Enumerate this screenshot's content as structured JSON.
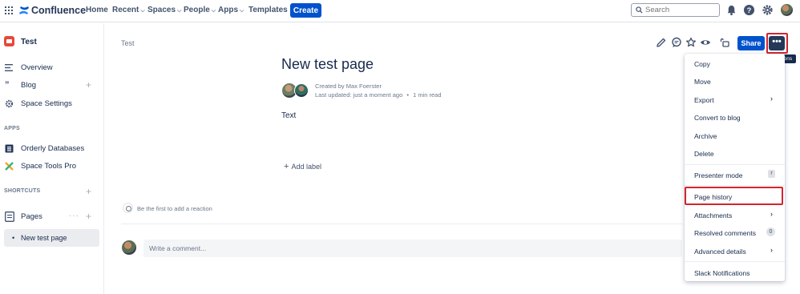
{
  "topnav": {
    "logo_text": "Confluence",
    "items": [
      {
        "label": "Home",
        "has_menu": false
      },
      {
        "label": "Recent",
        "has_menu": true
      },
      {
        "label": "Spaces",
        "has_menu": true
      },
      {
        "label": "People",
        "has_menu": true
      },
      {
        "label": "Apps",
        "has_menu": true
      },
      {
        "label": "Templates",
        "has_menu": false
      }
    ],
    "create_label": "Create",
    "search_placeholder": "Search",
    "icons": [
      "app-switcher-icon",
      "notifications-icon",
      "help-icon",
      "settings-icon"
    ],
    "brand_color": "#0052cc"
  },
  "sidebar": {
    "space_name": "Test",
    "items": [
      {
        "label": "Overview",
        "icon": "overview-icon"
      },
      {
        "label": "Blog",
        "icon": "blog-quote-icon"
      },
      {
        "label": "Space Settings",
        "icon": "gear-icon"
      }
    ],
    "apps_heading": "APPS",
    "apps": [
      {
        "label": "Orderly Databases",
        "icon": "database-icon"
      },
      {
        "label": "Space Tools Pro",
        "icon": "space-tools-icon"
      }
    ],
    "shortcuts_heading": "SHORTCUTS",
    "pages_label": "Pages",
    "tree": [
      {
        "label": "New test page",
        "selected": true
      }
    ]
  },
  "page": {
    "breadcrumb": "Test",
    "title": "New test page",
    "created_by": "Created by Max Foerster",
    "last_updated": "Last updated: just a moment ago",
    "separator": "•",
    "read_time": "1 min read",
    "body_text": "Text",
    "add_label": "Add label",
    "reaction_prompt": "Be the first to add a reaction",
    "comment_placeholder": "Write a comment..."
  },
  "toolbar": {
    "icons": [
      "edit-icon",
      "comment-icon",
      "star-icon",
      "watch-icon",
      "restrictions-icon"
    ],
    "share_label": "Share",
    "more_label": "•••",
    "more_tooltip": "More actions"
  },
  "menu": {
    "groups": [
      [
        {
          "label": "Copy"
        },
        {
          "label": "Move"
        },
        {
          "label": "Export",
          "submenu": true
        },
        {
          "label": "Convert to blog"
        },
        {
          "label": "Archive"
        },
        {
          "label": "Delete"
        }
      ],
      [
        {
          "label": "Presenter mode",
          "shortcut": "r"
        }
      ],
      [
        {
          "label": "Page history",
          "highlighted": true
        },
        {
          "label": "Attachments",
          "submenu": true
        },
        {
          "label": "Resolved comments",
          "badge": "0"
        },
        {
          "label": "Advanced details",
          "submenu": true
        }
      ],
      [
        {
          "label": "Slack Notifications"
        }
      ]
    ]
  },
  "highlight_color": "#d3252f"
}
